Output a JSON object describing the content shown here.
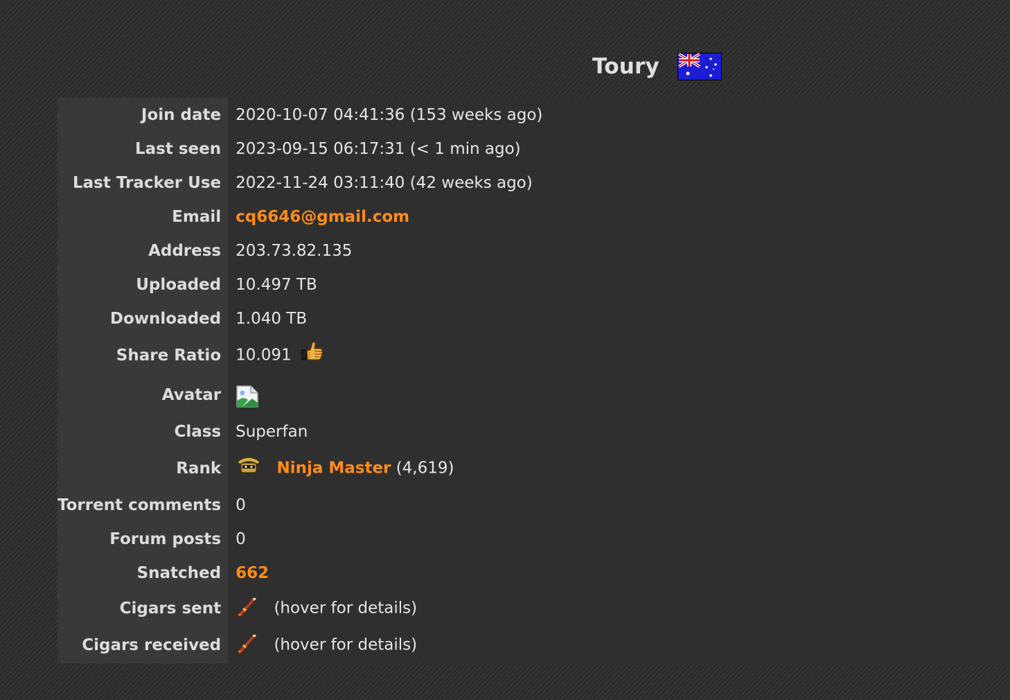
{
  "profile": {
    "username": "Toury",
    "country_flag_icon": "australia-flag-icon"
  },
  "fields": {
    "join_date": {
      "label": "Join date",
      "value": "2020-10-07 04:41:36 (153 weeks ago)"
    },
    "last_seen": {
      "label": "Last seen",
      "value": "2023-09-15 06:17:31 (< 1 min ago)"
    },
    "last_tracker_use": {
      "label": "Last Tracker Use",
      "value": "2022-11-24 03:11:40 (42 weeks ago)"
    },
    "email": {
      "label": "Email",
      "value": "cq6646@gmail.com"
    },
    "address": {
      "label": "Address",
      "value": "203.73.82.135"
    },
    "uploaded": {
      "label": "Uploaded",
      "value": "10.497 TB"
    },
    "downloaded": {
      "label": "Downloaded",
      "value": "1.040 TB"
    },
    "share_ratio": {
      "label": "Share Ratio",
      "value": "10.091",
      "icon": "thumbs-up-icon"
    },
    "avatar": {
      "label": "Avatar",
      "icon": "broken-image-icon"
    },
    "class": {
      "label": "Class",
      "value": "Superfan"
    },
    "rank": {
      "label": "Rank",
      "name": "Ninja Master",
      "points": "(4,619)",
      "icon": "ninja-rank-icon"
    },
    "torrent_comments": {
      "label": "Torrent comments",
      "value": "0"
    },
    "forum_posts": {
      "label": "Forum posts",
      "value": "0"
    },
    "snatched": {
      "label": "Snatched",
      "value": "662"
    },
    "cigars_sent": {
      "label": "Cigars sent",
      "value": "(hover for details)",
      "icon": "cigar-icon"
    },
    "cigars_received": {
      "label": "Cigars received",
      "value": "(hover for details)",
      "icon": "cigar-icon"
    }
  },
  "colors": {
    "accent_link": "#ff8c1a",
    "label_bg": "#393939",
    "value_bg": "#2f2f2f"
  }
}
